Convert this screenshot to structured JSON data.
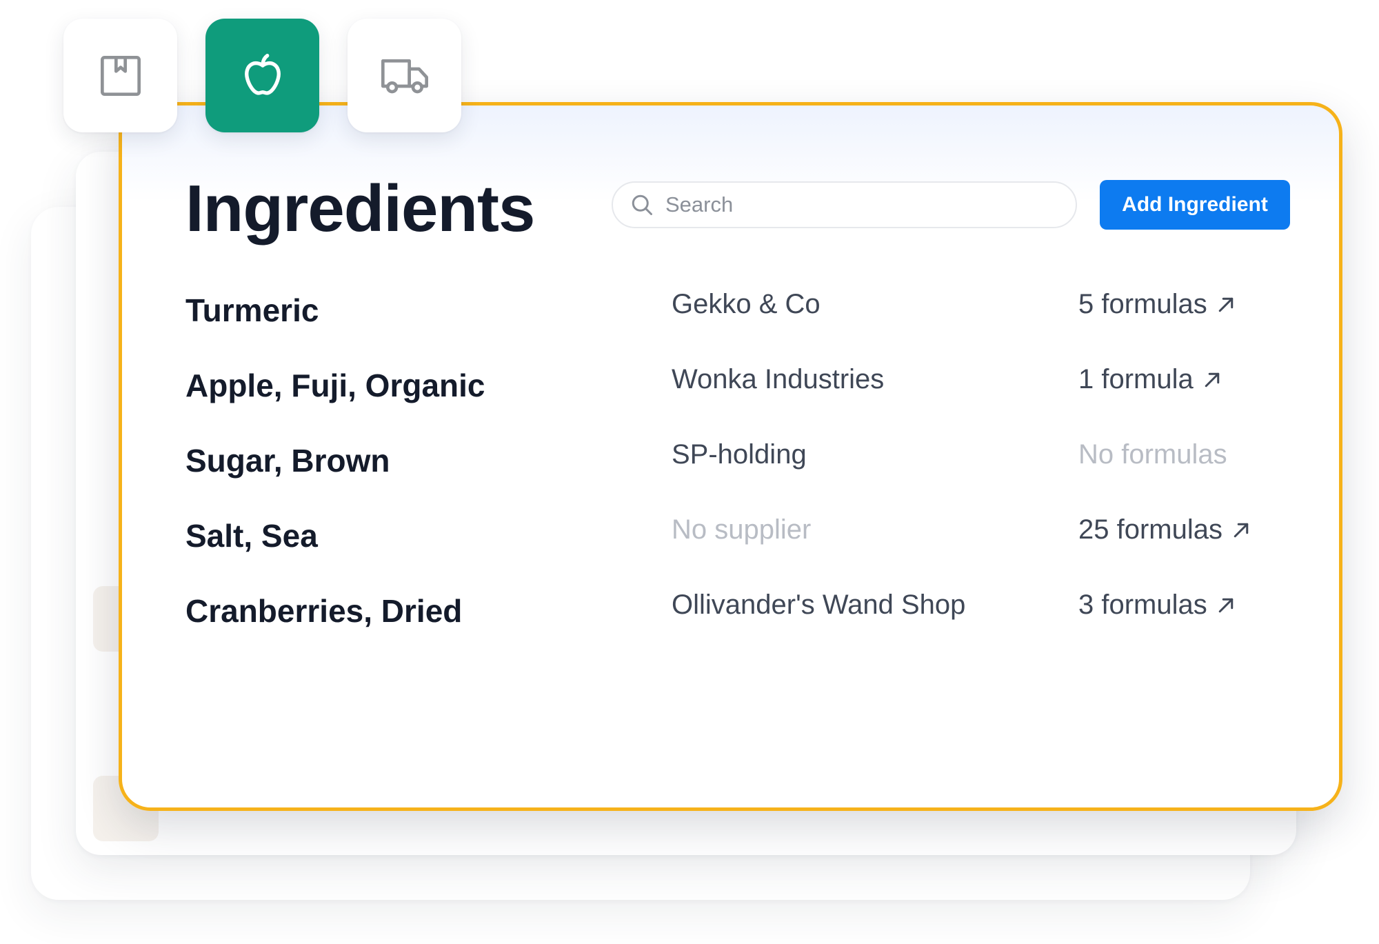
{
  "tabs": [
    {
      "icon": "package-icon",
      "active": false
    },
    {
      "icon": "apple-icon",
      "active": true
    },
    {
      "icon": "truck-icon",
      "active": false
    }
  ],
  "page": {
    "title": "Ingredients",
    "search_placeholder": "Search",
    "add_button_label": "Add Ingredient"
  },
  "ingredients": [
    {
      "name": "Turmeric",
      "supplier": "Gekko & Co",
      "formulas": "5 formulas",
      "has_link": true
    },
    {
      "name": "Apple, Fuji, Organic",
      "supplier": "Wonka Industries",
      "formulas": "1 formula",
      "has_link": true
    },
    {
      "name": "Sugar, Brown",
      "supplier": "SP-holding",
      "formulas": "No formulas",
      "has_link": false
    },
    {
      "name": "Salt, Sea",
      "supplier": "No supplier",
      "formulas": "25 formulas",
      "has_link": true
    },
    {
      "name": "Cranberries, Dried",
      "supplier": "Ollivander's Wand Shop",
      "formulas": "3 formulas",
      "has_link": true
    }
  ],
  "colors": {
    "accent_border": "#f6b21a",
    "active_tab": "#0f9c7c",
    "primary_button": "#0d7bf0",
    "muted_text": "#b8bcc4"
  }
}
